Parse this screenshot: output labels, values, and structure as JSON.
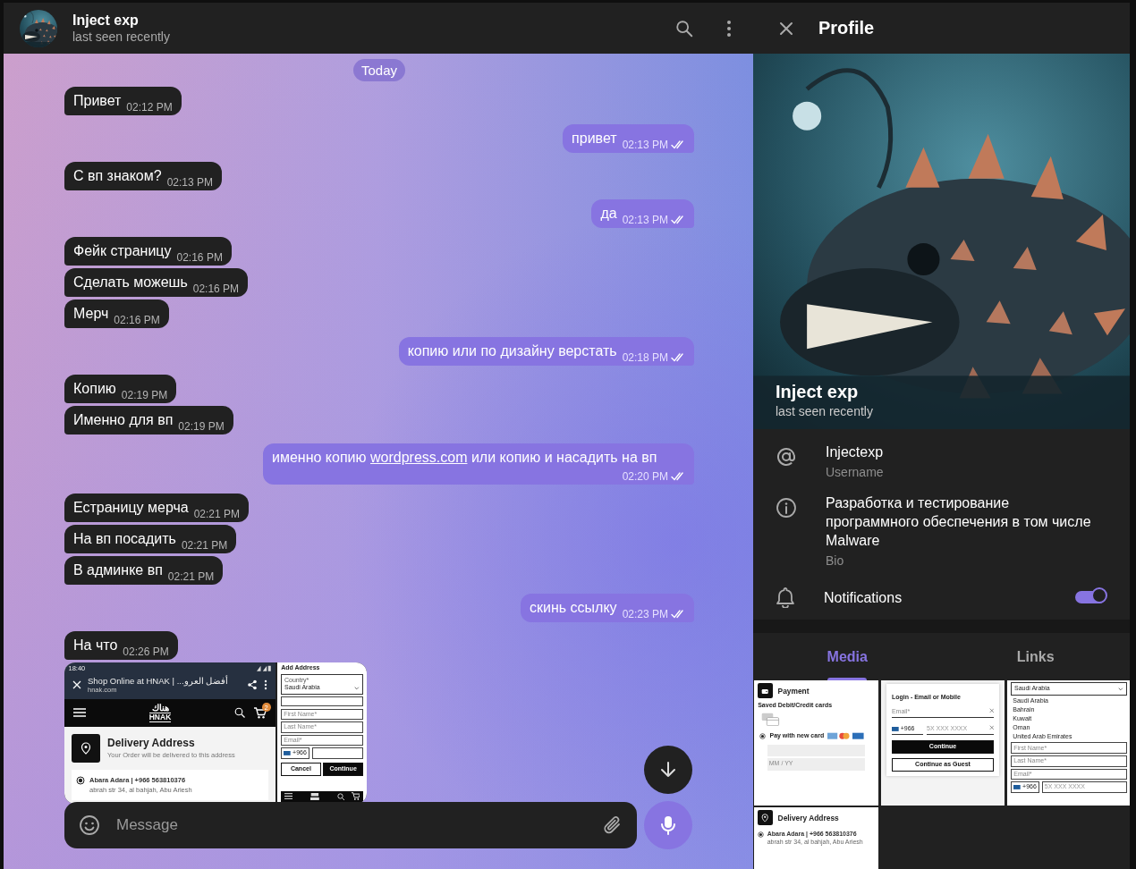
{
  "chat": {
    "title": "Inject exp",
    "status": "last seen recently",
    "date": "Today",
    "messages": [
      {
        "kind": "text",
        "out": false,
        "text": "Привет",
        "time": "02:12 PM"
      },
      {
        "kind": "text",
        "out": true,
        "text": "привет",
        "time": "02:13 PM",
        "read": true
      },
      {
        "kind": "text",
        "out": false,
        "text": "С вп знаком?",
        "time": "02:13 PM"
      },
      {
        "kind": "text",
        "out": true,
        "text": "да",
        "time": "02:13 PM",
        "read": true
      },
      {
        "kind": "text",
        "out": false,
        "text": "Фейк страницу",
        "time": "02:16 PM"
      },
      {
        "kind": "text",
        "out": false,
        "text": "Сделать можешь",
        "time": "02:16 PM"
      },
      {
        "kind": "text",
        "out": false,
        "text": "Мерч",
        "time": "02:16 PM"
      },
      {
        "kind": "text",
        "out": true,
        "text": "копию или по дизайну верстать",
        "time": "02:18 PM",
        "read": true
      },
      {
        "kind": "text",
        "out": false,
        "text": "Копию",
        "time": "02:19 PM"
      },
      {
        "kind": "text",
        "out": false,
        "text": "Именно для вп",
        "time": "02:19 PM"
      },
      {
        "kind": "linked",
        "out": true,
        "parts": [
          {
            "kind": "text",
            "text": "именно копию "
          },
          {
            "kind": "link",
            "text": "wordpress.com"
          },
          {
            "kind": "text",
            "text": " или копию и насадить на вп"
          }
        ],
        "time": "02:20 PM",
        "read": true
      },
      {
        "kind": "text",
        "out": false,
        "text": "Естраницу мерча",
        "time": "02:21 PM"
      },
      {
        "kind": "text",
        "out": false,
        "text": "На вп посадить",
        "time": "02:21 PM"
      },
      {
        "kind": "text",
        "out": false,
        "text": "В админке вп",
        "time": "02:21 PM"
      },
      {
        "kind": "text",
        "out": true,
        "text": "скинь ссылку",
        "time": "02:23 PM",
        "read": true
      },
      {
        "kind": "text",
        "out": false,
        "text": "На что",
        "time": "02:26 PM"
      },
      {
        "out": false,
        "shots": [
          {
            "kind": "phone",
            "rows": [
              {
                "kind": "statusbar",
                "text": "18:40"
              },
              {
                "kind": "browserbar",
                "title": "Shop Online at HNAK | ...أفضل العرو",
                "url": "hnak.com"
              },
              {
                "kind": "sitebar",
                "logo_ar": "هناك",
                "logo": "HNAK",
                "badge": "2"
              },
              {
                "kind": "delivery-section",
                "title": "Delivery Address",
                "text": "Your Order will be delivered to this address"
              },
              {
                "kind": "address",
                "title": "Abara Adara | +966 563810376",
                "lines": [
                  "abrah str 34, al bahjah, Abu Ariesh"
                ]
              }
            ]
          },
          {
            "kind": "form",
            "rows": [
              {
                "kind": "heading",
                "text": "Add Address"
              },
              {
                "kind": "dropdown",
                "label": "Country*",
                "value": "Saudi Arabia"
              },
              {
                "kind": "blank-field"
              },
              {
                "kind": "field",
                "text": "First Name*"
              },
              {
                "kind": "field",
                "text": "Last Name*"
              },
              {
                "kind": "field",
                "text": "Email*"
              },
              {
                "kind": "phone",
                "code": "+966"
              },
              {
                "kind": "buttons",
                "items": [
                  {
                    "text": "Cancel",
                    "primary": false
                  },
                  {
                    "text": "Continue",
                    "primary": true
                  }
                ]
              },
              {
                "kind": "sitebar"
              }
            ]
          }
        ]
      }
    ],
    "composer": {
      "placeholder": "Message"
    }
  },
  "profile": {
    "title": "Profile",
    "name": "Inject exp",
    "status": "last seen recently",
    "rows": [
      {
        "kind": "username",
        "value": "Injectexp",
        "label": "Username"
      },
      {
        "kind": "bio",
        "value": "Разработка и тестирование программного обеспечения в том числе Malware",
        "label": "Bio"
      },
      {
        "kind": "notifications",
        "label": "Notifications",
        "on": true
      }
    ],
    "tabs": [
      {
        "label": "Media",
        "selected": true
      },
      {
        "label": "Links",
        "selected": false
      }
    ],
    "media": [
      {
        "kind": "form",
        "rows": [
          {
            "kind": "payment-section",
            "title": "Payment"
          },
          {
            "kind": "heading",
            "text": "Saved Debit/Credit cards"
          },
          {
            "kind": "card-note"
          },
          {
            "kind": "radio",
            "title": "Pay with new card"
          },
          {
            "kind": "blank-field"
          },
          {
            "kind": "grey-field",
            "text": "MM / YY"
          }
        ]
      },
      {
        "kind": "card",
        "rows": [
          {
            "kind": "heading",
            "text": "Login - Email or Mobile"
          },
          {
            "kind": "line-field",
            "text": "Email*"
          },
          {
            "kind": "phone-line",
            "code": "+966",
            "text": "5X XXX XXXX"
          },
          {
            "kind": "button",
            "text": "Continue",
            "primary": true
          },
          {
            "kind": "button",
            "text": "Continue as Guest",
            "primary": false
          }
        ]
      },
      {
        "kind": "form",
        "rows": [
          {
            "kind": "dropdown",
            "value": "Saudi Arabia"
          },
          {
            "kind": "option",
            "text": "Saudi Arabia"
          },
          {
            "kind": "option",
            "text": "Bahrain"
          },
          {
            "kind": "option",
            "text": "Kuwait"
          },
          {
            "kind": "option",
            "text": "Oman"
          },
          {
            "kind": "option",
            "text": "United Arab Emirates"
          },
          {
            "kind": "field",
            "text": "First Name*"
          },
          {
            "kind": "field",
            "text": "Last Name*"
          },
          {
            "kind": "field",
            "text": "Email*"
          },
          {
            "kind": "phone",
            "code": "+966",
            "text": "5X XXX XXXX"
          }
        ]
      },
      {
        "kind": "form",
        "rows": [
          {
            "kind": "delivery-section",
            "title": "Delivery Address"
          },
          {
            "kind": "address",
            "title": "Abara Adara | +966 563810376",
            "lines": [
              "abrah str 34, al bahjah, Abu Ariesh"
            ]
          }
        ]
      }
    ]
  }
}
